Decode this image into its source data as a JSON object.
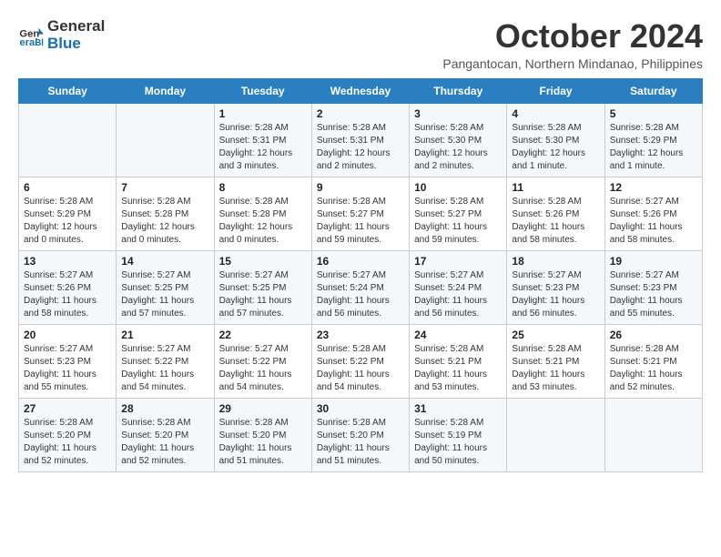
{
  "logo": {
    "line1": "General",
    "line2": "Blue"
  },
  "title": "October 2024",
  "location": "Pangantocan, Northern Mindanao, Philippines",
  "weekdays": [
    "Sunday",
    "Monday",
    "Tuesday",
    "Wednesday",
    "Thursday",
    "Friday",
    "Saturday"
  ],
  "weeks": [
    [
      {
        "day": "",
        "detail": ""
      },
      {
        "day": "",
        "detail": ""
      },
      {
        "day": "1",
        "detail": "Sunrise: 5:28 AM\nSunset: 5:31 PM\nDaylight: 12 hours\nand 3 minutes."
      },
      {
        "day": "2",
        "detail": "Sunrise: 5:28 AM\nSunset: 5:31 PM\nDaylight: 12 hours\nand 2 minutes."
      },
      {
        "day": "3",
        "detail": "Sunrise: 5:28 AM\nSunset: 5:30 PM\nDaylight: 12 hours\nand 2 minutes."
      },
      {
        "day": "4",
        "detail": "Sunrise: 5:28 AM\nSunset: 5:30 PM\nDaylight: 12 hours\nand 1 minute."
      },
      {
        "day": "5",
        "detail": "Sunrise: 5:28 AM\nSunset: 5:29 PM\nDaylight: 12 hours\nand 1 minute."
      }
    ],
    [
      {
        "day": "6",
        "detail": "Sunrise: 5:28 AM\nSunset: 5:29 PM\nDaylight: 12 hours\nand 0 minutes."
      },
      {
        "day": "7",
        "detail": "Sunrise: 5:28 AM\nSunset: 5:28 PM\nDaylight: 12 hours\nand 0 minutes."
      },
      {
        "day": "8",
        "detail": "Sunrise: 5:28 AM\nSunset: 5:28 PM\nDaylight: 12 hours\nand 0 minutes."
      },
      {
        "day": "9",
        "detail": "Sunrise: 5:28 AM\nSunset: 5:27 PM\nDaylight: 11 hours\nand 59 minutes."
      },
      {
        "day": "10",
        "detail": "Sunrise: 5:28 AM\nSunset: 5:27 PM\nDaylight: 11 hours\nand 59 minutes."
      },
      {
        "day": "11",
        "detail": "Sunrise: 5:28 AM\nSunset: 5:26 PM\nDaylight: 11 hours\nand 58 minutes."
      },
      {
        "day": "12",
        "detail": "Sunrise: 5:27 AM\nSunset: 5:26 PM\nDaylight: 11 hours\nand 58 minutes."
      }
    ],
    [
      {
        "day": "13",
        "detail": "Sunrise: 5:27 AM\nSunset: 5:26 PM\nDaylight: 11 hours\nand 58 minutes."
      },
      {
        "day": "14",
        "detail": "Sunrise: 5:27 AM\nSunset: 5:25 PM\nDaylight: 11 hours\nand 57 minutes."
      },
      {
        "day": "15",
        "detail": "Sunrise: 5:27 AM\nSunset: 5:25 PM\nDaylight: 11 hours\nand 57 minutes."
      },
      {
        "day": "16",
        "detail": "Sunrise: 5:27 AM\nSunset: 5:24 PM\nDaylight: 11 hours\nand 56 minutes."
      },
      {
        "day": "17",
        "detail": "Sunrise: 5:27 AM\nSunset: 5:24 PM\nDaylight: 11 hours\nand 56 minutes."
      },
      {
        "day": "18",
        "detail": "Sunrise: 5:27 AM\nSunset: 5:23 PM\nDaylight: 11 hours\nand 56 minutes."
      },
      {
        "day": "19",
        "detail": "Sunrise: 5:27 AM\nSunset: 5:23 PM\nDaylight: 11 hours\nand 55 minutes."
      }
    ],
    [
      {
        "day": "20",
        "detail": "Sunrise: 5:27 AM\nSunset: 5:23 PM\nDaylight: 11 hours\nand 55 minutes."
      },
      {
        "day": "21",
        "detail": "Sunrise: 5:27 AM\nSunset: 5:22 PM\nDaylight: 11 hours\nand 54 minutes."
      },
      {
        "day": "22",
        "detail": "Sunrise: 5:27 AM\nSunset: 5:22 PM\nDaylight: 11 hours\nand 54 minutes."
      },
      {
        "day": "23",
        "detail": "Sunrise: 5:28 AM\nSunset: 5:22 PM\nDaylight: 11 hours\nand 54 minutes."
      },
      {
        "day": "24",
        "detail": "Sunrise: 5:28 AM\nSunset: 5:21 PM\nDaylight: 11 hours\nand 53 minutes."
      },
      {
        "day": "25",
        "detail": "Sunrise: 5:28 AM\nSunset: 5:21 PM\nDaylight: 11 hours\nand 53 minutes."
      },
      {
        "day": "26",
        "detail": "Sunrise: 5:28 AM\nSunset: 5:21 PM\nDaylight: 11 hours\nand 52 minutes."
      }
    ],
    [
      {
        "day": "27",
        "detail": "Sunrise: 5:28 AM\nSunset: 5:20 PM\nDaylight: 11 hours\nand 52 minutes."
      },
      {
        "day": "28",
        "detail": "Sunrise: 5:28 AM\nSunset: 5:20 PM\nDaylight: 11 hours\nand 52 minutes."
      },
      {
        "day": "29",
        "detail": "Sunrise: 5:28 AM\nSunset: 5:20 PM\nDaylight: 11 hours\nand 51 minutes."
      },
      {
        "day": "30",
        "detail": "Sunrise: 5:28 AM\nSunset: 5:20 PM\nDaylight: 11 hours\nand 51 minutes."
      },
      {
        "day": "31",
        "detail": "Sunrise: 5:28 AM\nSunset: 5:19 PM\nDaylight: 11 hours\nand 50 minutes."
      },
      {
        "day": "",
        "detail": ""
      },
      {
        "day": "",
        "detail": ""
      }
    ]
  ]
}
